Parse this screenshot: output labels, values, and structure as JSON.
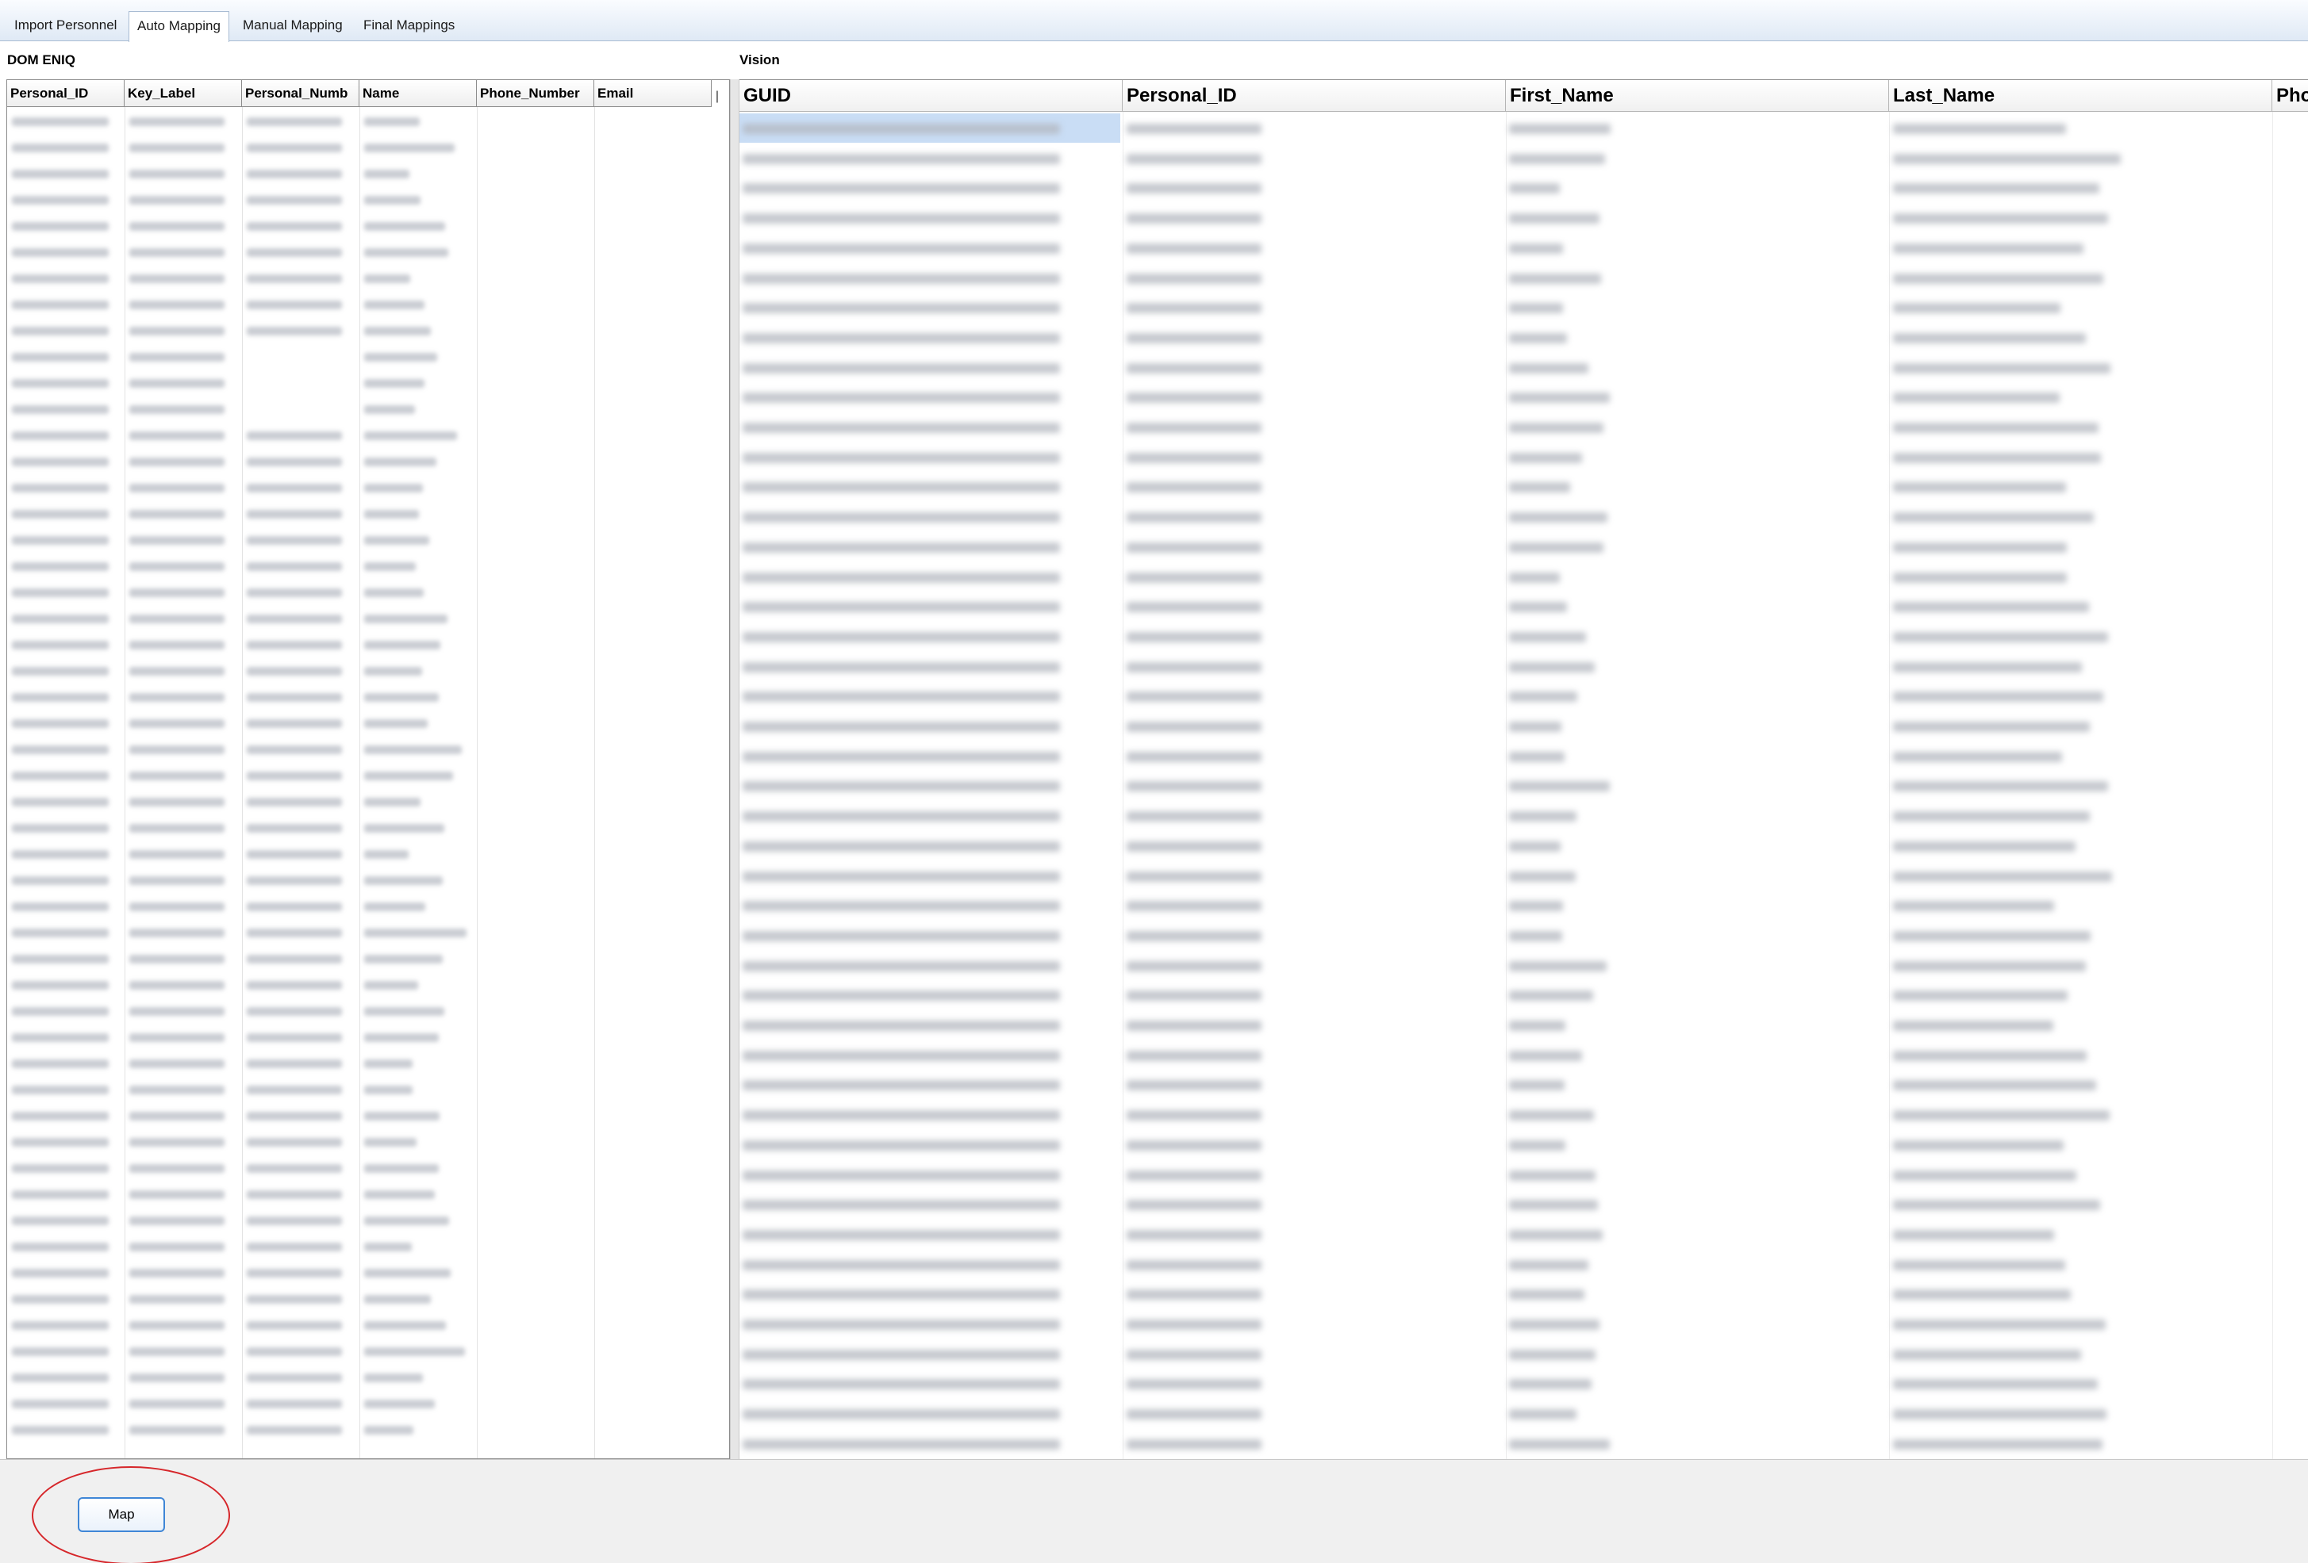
{
  "tabs": [
    {
      "label": "Import Personnel"
    },
    {
      "label": "Auto Mapping",
      "active": true
    },
    {
      "label": "Manual Mapping"
    },
    {
      "label": "Final Mappings"
    }
  ],
  "left_panel": {
    "title": "DOM ENIQ",
    "columns": [
      "Personal_ID",
      "Key_Label",
      "Personal_Numb",
      "Name",
      "Phone_Number",
      "Email"
    ],
    "resize_glyph": "|",
    "row_count": 51
  },
  "right_panel": {
    "title": "Vision",
    "columns": [
      "GUID",
      "Personal_ID",
      "First_Name",
      "Last_Name",
      "Pho"
    ],
    "row_count": 45
  },
  "actions": {
    "map_label": "Map"
  },
  "colors": {
    "highlight_circle": "#d6262a",
    "button_border": "#3f86d6",
    "selected_row": "#c9ddf5"
  }
}
